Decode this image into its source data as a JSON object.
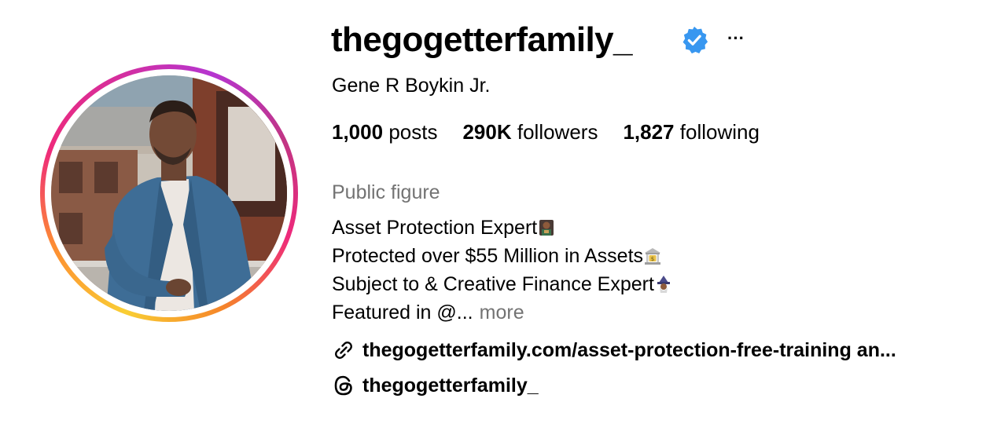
{
  "profile": {
    "username": "thegogetterfamily_",
    "verified": true,
    "more_options": "···",
    "full_name": "Gene R Boykin Jr.",
    "avatar_icon": "profile-photo-icon",
    "story_ring_colors": [
      "#f9ce34",
      "#ee2a7b",
      "#b535d0"
    ],
    "verified_color": "#3897f0"
  },
  "stats": {
    "posts": {
      "value": "1,000",
      "label": "posts"
    },
    "followers": {
      "value": "290K",
      "label": "followers"
    },
    "following": {
      "value": "1,827",
      "label": "following"
    }
  },
  "bio": {
    "category": "Public figure",
    "lines": [
      {
        "text": "Asset Protection Expert",
        "emoji": "briefcase-person-emoji"
      },
      {
        "text": "Protected over $55 Million in Assets",
        "emoji": "bank-emoji"
      },
      {
        "text": "Subject to & Creative Finance Expert",
        "emoji": "wizard-emoji"
      },
      {
        "text": "Featured in @...",
        "emoji": ""
      }
    ],
    "more_label": "more"
  },
  "links": {
    "website": {
      "icon": "link-icon",
      "text": "thegogetterfamily.com/asset-protection-free-training an..."
    },
    "threads": {
      "icon": "threads-icon",
      "text": "thegogetterfamily_"
    }
  }
}
